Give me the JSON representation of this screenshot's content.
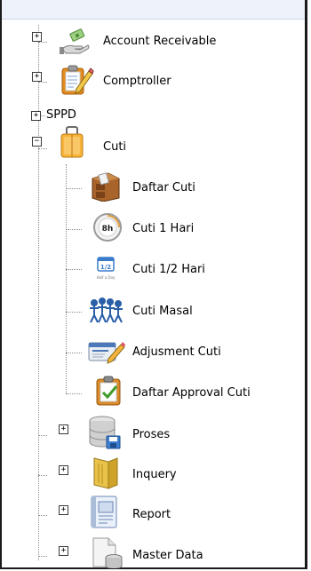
{
  "tree": {
    "account_receivable": "Account Receivable",
    "comptroller": "Comptroller",
    "sppd": "SPPD",
    "cuti": "Cuti",
    "cuti_children": [
      "Daftar Cuti",
      "Cuti 1 Hari",
      "Cuti 1/2 Hari",
      "Cuti Masal",
      "Adjusment Cuti",
      "Daftar Approval Cuti"
    ],
    "proses": "Proses",
    "inquery": "Inquery",
    "report": "Report",
    "master_data": "Master Data"
  },
  "icon_text": {
    "clock_8h": "8h",
    "half_day_fraction": "1/2",
    "half_day_caption": "Half a Day"
  },
  "toggle": {
    "expand": "+",
    "collapse": "−"
  },
  "icons": {
    "account_receivable": "money-hand-icon",
    "comptroller": "clipboard-pencil-icon",
    "cuti": "suitcase-icon",
    "daftar_cuti": "file-cabinet-icon",
    "cuti_1_hari": "clock-8h-icon",
    "cuti_half_hari": "calendar-half-day-icon",
    "cuti_masal": "people-group-icon",
    "adjusment_cuti": "card-pencil-icon",
    "daftar_approval_cuti": "clipboard-check-icon",
    "proses": "database-icon",
    "inquery": "folder-icon",
    "report": "report-book-icon",
    "master_data": "document-database-icon"
  }
}
